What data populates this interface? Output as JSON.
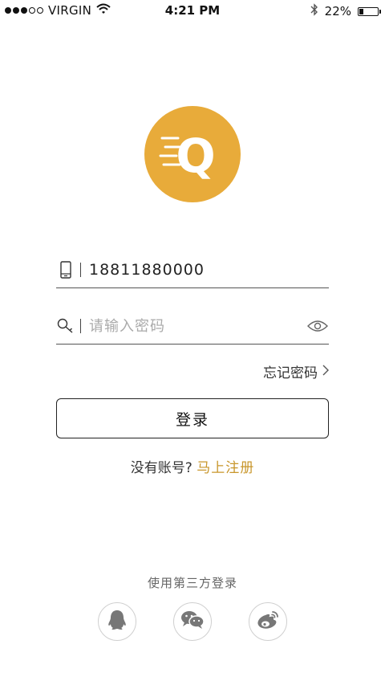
{
  "status_bar": {
    "carrier": "VIRGIN",
    "signal_bars_filled": 3,
    "signal_bars_total": 5,
    "time": "4:21 PM",
    "battery_percent": "22%",
    "battery_level": 0.22,
    "icons": [
      "wifi-icon",
      "bluetooth-icon",
      "battery-icon"
    ]
  },
  "logo": {
    "letter": "Q",
    "color": "#e8ab3a"
  },
  "login_form": {
    "phone": {
      "value": "18811880000",
      "icon": "phone-icon"
    },
    "password": {
      "placeholder": "请输入密码",
      "icon": "key-icon",
      "toggle_icon": "eye-icon"
    },
    "forgot_password": "忘记密码",
    "submit_label": "登录"
  },
  "register": {
    "prompt": "没有账号?",
    "link": "马上注册",
    "link_color": "#c8962b"
  },
  "third_party": {
    "title": "使用第三方登录",
    "providers": [
      {
        "name": "qq",
        "icon": "qq-icon"
      },
      {
        "name": "wechat",
        "icon": "wechat-icon"
      },
      {
        "name": "weibo",
        "icon": "weibo-icon"
      }
    ]
  }
}
